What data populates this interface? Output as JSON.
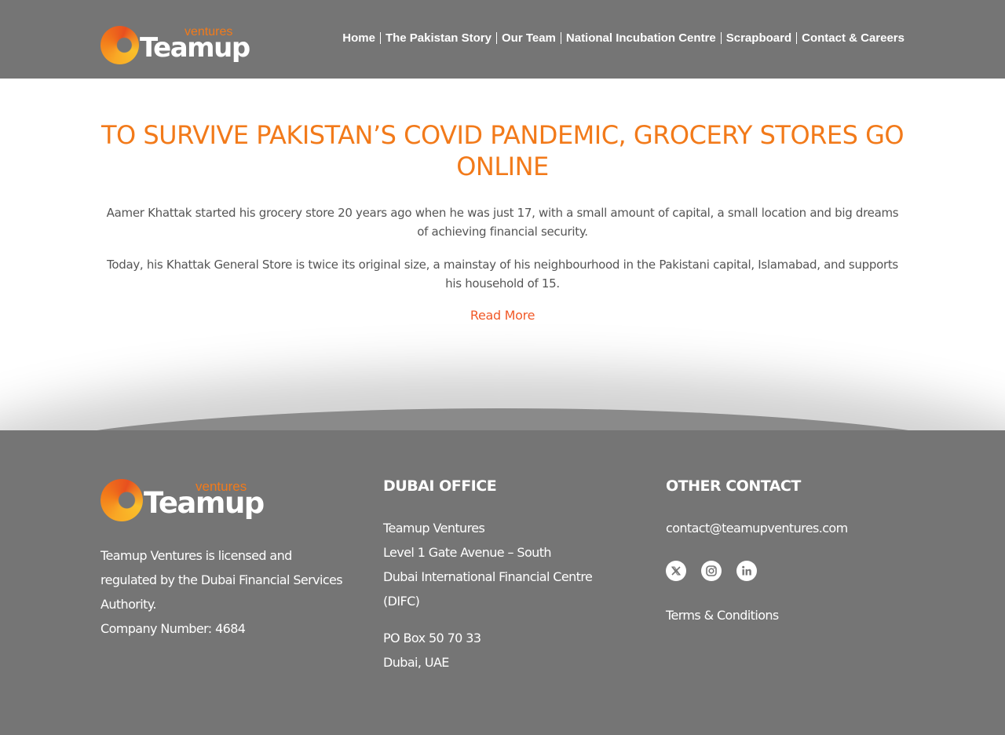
{
  "header": {
    "logo": {
      "main": "Teamup",
      "sub": "ventures"
    },
    "nav": [
      {
        "label": "Home"
      },
      {
        "label": "The Pakistan Story"
      },
      {
        "label": "Our Team"
      },
      {
        "label": "National Incubation Centre"
      },
      {
        "label": "Scrapboard"
      },
      {
        "label": "Contact & Careers"
      }
    ]
  },
  "article": {
    "title": "TO SURVIVE PAKISTAN’S COVID PANDEMIC, GROCERY STORES GO ONLINE",
    "paragraphs": [
      "Aamer Khattak started his grocery store 20 years ago when he was just 17, with a small amount of capital, a small location and big dreams of achieving financial security.",
      "Today, his Khattak General Store is twice its original size, a mainstay of his neighbourhood in the Pakistani capital, Islamabad, and supports his household of 15."
    ],
    "read_more": "Read More"
  },
  "footer": {
    "logo": {
      "main": "Teamup",
      "sub": "ventures"
    },
    "license_text": "Teamup Ventures is licensed and regulated by the Dubai Financial Services Authority.",
    "company_number": "Company Number: 4684",
    "dubai_office": {
      "heading": "DUBAI OFFICE",
      "lines": [
        "Teamup Ventures",
        "Level 1 Gate Avenue – South",
        "Dubai International Financial Centre",
        "(DIFC)"
      ],
      "po_lines": [
        "PO Box 50 70 33",
        "Dubai, UAE"
      ]
    },
    "other_contact": {
      "heading": "OTHER CONTACT",
      "email": "contact@teamupventures.com",
      "socials": [
        {
          "icon": "x-twitter-icon"
        },
        {
          "icon": "instagram-icon"
        },
        {
          "icon": "linkedin-icon"
        }
      ],
      "terms": "Terms & Conditions"
    }
  },
  "colors": {
    "header_bg": "#757575",
    "footer_bg": "#757575",
    "accent_orange": "#f27a1a",
    "link_red": "#f15a29",
    "body_text": "#555555"
  }
}
